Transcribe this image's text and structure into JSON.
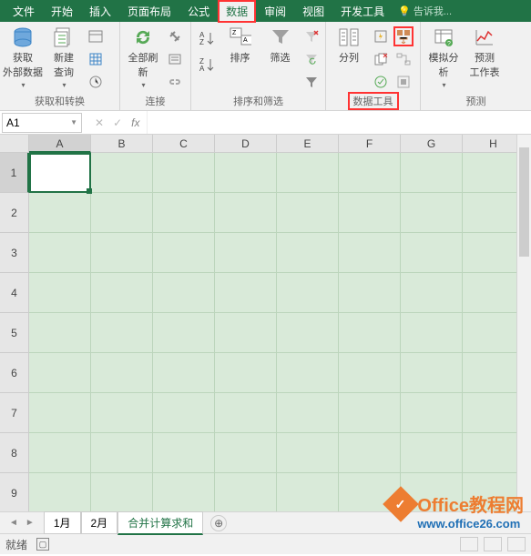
{
  "tabs": {
    "file": "文件",
    "home": "开始",
    "insert": "插入",
    "layout": "页面布局",
    "formula": "公式",
    "data": "数据",
    "review": "审阅",
    "view": "视图",
    "dev": "开发工具",
    "tellme": "告诉我..."
  },
  "ribbon": {
    "getdata": {
      "getext": "获取\n外部数据",
      "newquery": "新建\n查询",
      "group": "获取和转换"
    },
    "connections": {
      "refresh": "全部刷新",
      "group": "连接"
    },
    "sort": {
      "sort": "排序",
      "filter": "筛选",
      "group": "排序和筛选"
    },
    "datatools": {
      "t2c": "分列",
      "group": "数据工具"
    },
    "forecast": {
      "whatif": "模拟分析",
      "sheet": "预测\n工作表",
      "group": "预测"
    }
  },
  "namebox": "A1",
  "columns": [
    "A",
    "B",
    "C",
    "D",
    "E",
    "F",
    "G",
    "H"
  ],
  "rows": [
    "1",
    "2",
    "3",
    "4",
    "5",
    "6",
    "7",
    "8",
    "9"
  ],
  "sheets": {
    "s1": "1月",
    "s2": "2月",
    "s3": "合并计算求和"
  },
  "status": {
    "ready": "就绪"
  },
  "watermark": {
    "title": "Office教程网",
    "url": "www.office26.com"
  }
}
